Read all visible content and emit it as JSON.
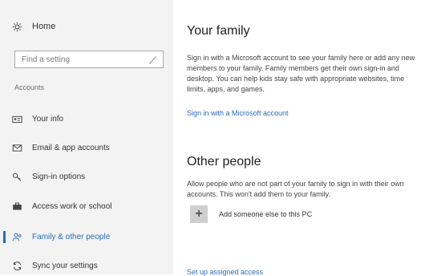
{
  "sidebar": {
    "home_label": "Home",
    "search_placeholder": "Find a setting",
    "section_label": "Accounts",
    "items": [
      {
        "label": "Your info"
      },
      {
        "label": "Email & app accounts"
      },
      {
        "label": "Sign-in options"
      },
      {
        "label": "Access work or school"
      },
      {
        "label": "Family & other people"
      },
      {
        "label": "Sync your settings"
      }
    ]
  },
  "main": {
    "family": {
      "title": "Your family",
      "description": "Sign in with a Microsoft account to see your family here or add any new members to your family. Family members get their own sign-in and desktop. You can help kids stay safe with appropriate websites, time limits, apps, and games.",
      "link": "Sign in with a Microsoft account"
    },
    "other": {
      "title": "Other people",
      "description": "Allow people who are not part of your family to sign in with their own accounts. This won't add them to your family.",
      "add_label": "Add someone else to this PC",
      "add_symbol": "+",
      "link_partial": "Set up assigned access"
    }
  },
  "colors": {
    "accent": "#2b6cb8",
    "sidebar_bg": "#f3f3f3"
  }
}
